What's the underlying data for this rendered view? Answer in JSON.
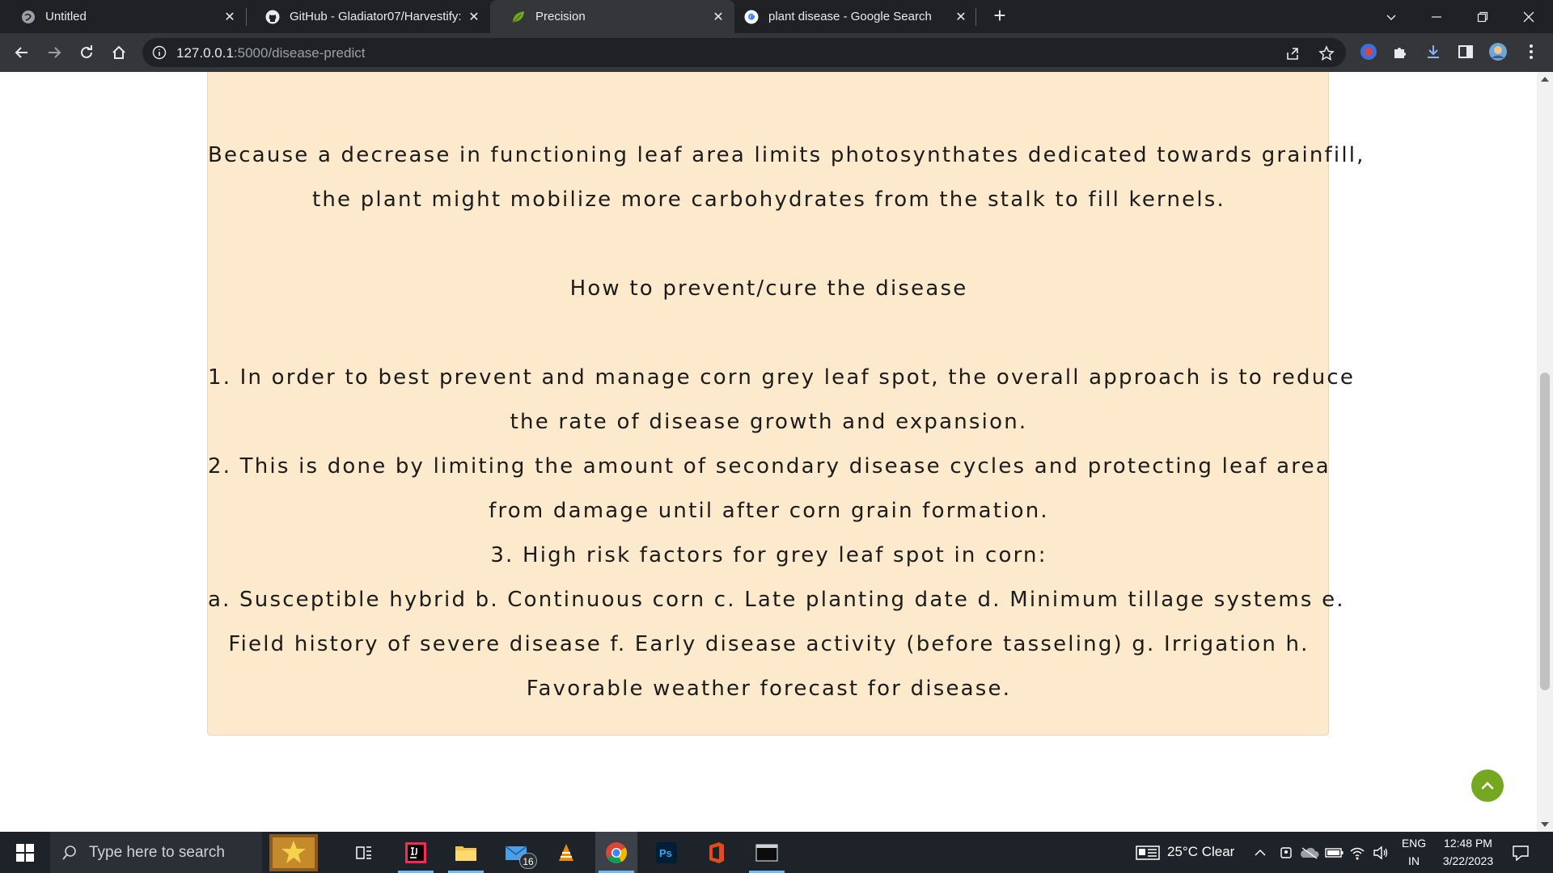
{
  "browser": {
    "tabs": [
      {
        "title": "Untitled",
        "icon": "globe-icon",
        "active": false
      },
      {
        "title": "GitHub - Gladiator07/Harvestify:",
        "icon": "github-icon",
        "active": false
      },
      {
        "title": "Precision",
        "icon": "leaf-icon",
        "active": true
      },
      {
        "title": "plant disease - Google Search",
        "icon": "google-icon",
        "active": false
      }
    ],
    "url_host": "127.0.0.1",
    "url_path": ":5000/disease-predict"
  },
  "content": {
    "intro_line_1": "Because a decrease in functioning leaf area limits photosynthates dedicated towards grainfill,",
    "intro_line_2": "the plant might mobilize more carbohydrates from the stalk to fill kernels.",
    "prevent_heading": "How to prevent/cure the disease",
    "steps": [
      "1. In order to best prevent and manage corn grey leaf spot, the overall approach is to reduce",
      "the rate of disease growth and expansion.",
      "2. This is done by limiting the amount of secondary disease cycles and protecting leaf area",
      "from damage until after corn grain formation.",
      "3. High risk factors for grey leaf spot in corn:",
      "a. Susceptible hybrid b. Continuous corn c. Late planting date d. Minimum tillage systems e.",
      "Field history of severe disease f. Early disease activity (before tasseling) g. Irrigation h.",
      "Favorable weather forecast for disease."
    ]
  },
  "taskbar": {
    "search_placeholder": "Type here to search",
    "mail_badge": "16",
    "weather": "25°C  Clear",
    "language": "ENG",
    "region": "IN",
    "time": "12:48 PM",
    "date": "3/22/2023"
  },
  "colors": {
    "card_bg": "#fde9cb",
    "scroll_top_button": "#74a81f",
    "chrome_dark": "#202124",
    "chrome_toolbar": "#35363a"
  }
}
